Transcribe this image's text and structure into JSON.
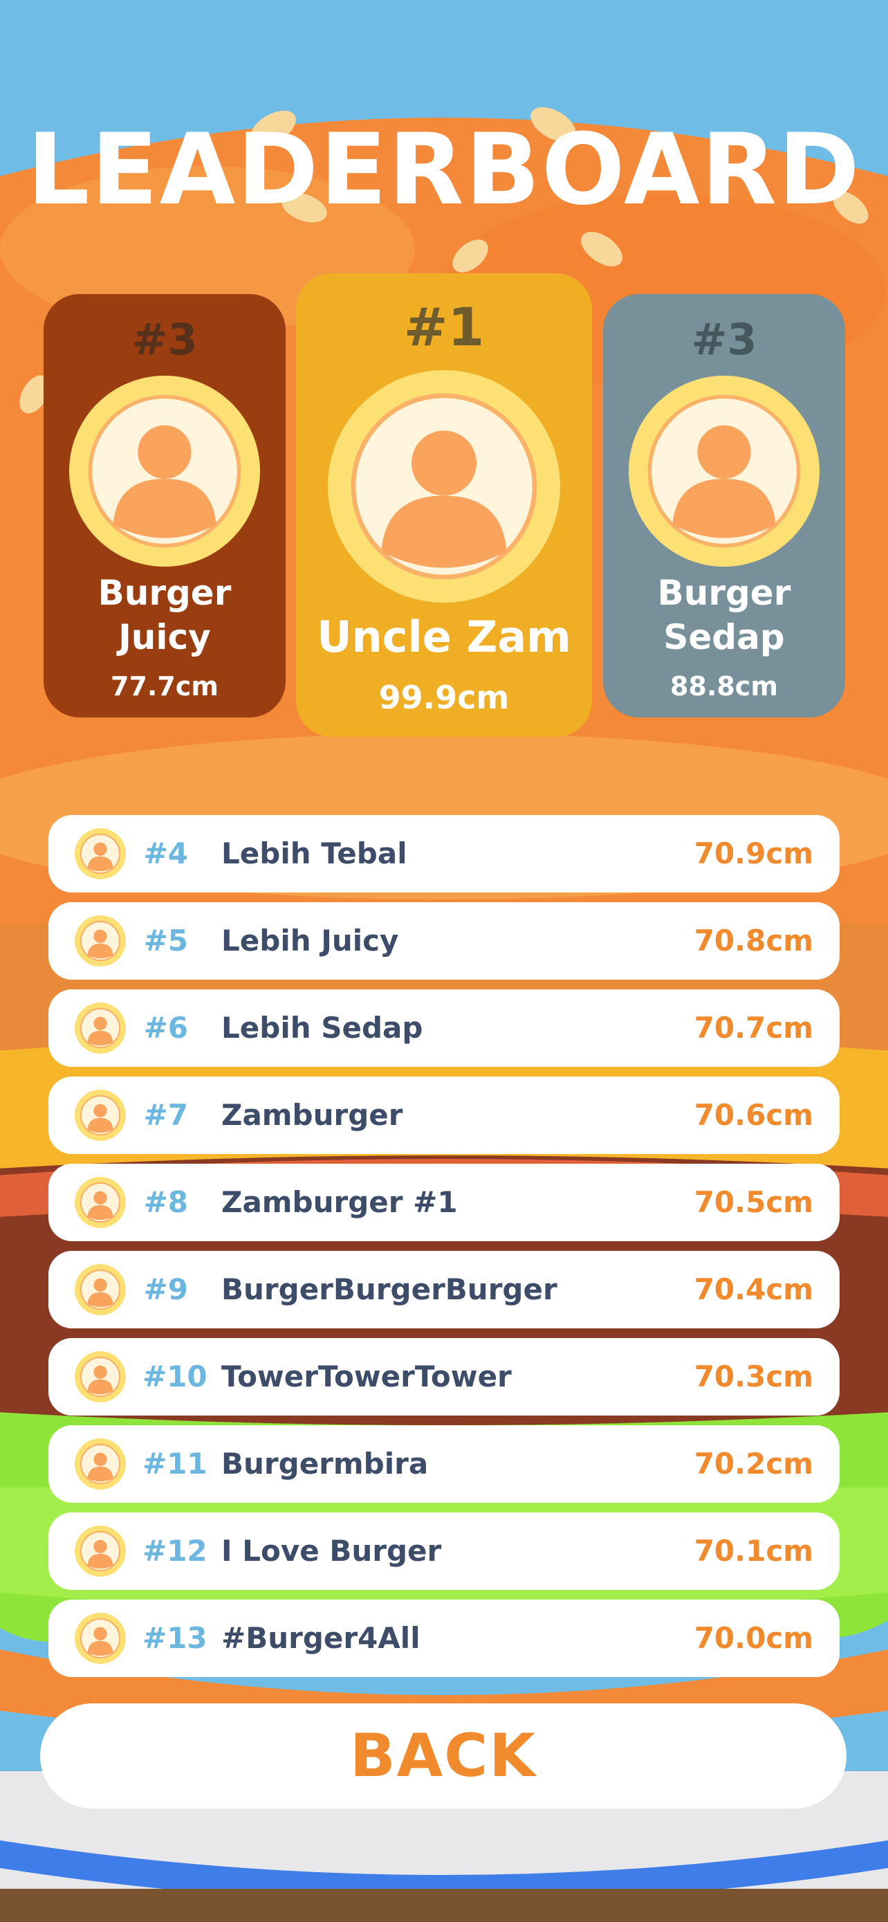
{
  "title": "LEADERBOARD",
  "podium": {
    "left": {
      "rank": "#3",
      "name_line1": "Burger",
      "name_line2": "Juicy",
      "score": "77.7cm"
    },
    "center": {
      "rank": "#1",
      "name": "Uncle Zam",
      "score": "99.9cm"
    },
    "right": {
      "rank": "#3",
      "name_line1": "Burger",
      "name_line2": "Sedap",
      "score": "88.8cm"
    }
  },
  "rows": [
    {
      "rank": "#4",
      "name": "Lebih Tebal",
      "score": "70.9cm"
    },
    {
      "rank": "#5",
      "name": "Lebih Juicy",
      "score": "70.8cm"
    },
    {
      "rank": "#6",
      "name": "Lebih Sedap",
      "score": "70.7cm"
    },
    {
      "rank": "#7",
      "name": "Zamburger",
      "score": "70.6cm"
    },
    {
      "rank": "#8",
      "name": "Zamburger #1",
      "score": "70.5cm"
    },
    {
      "rank": "#9",
      "name": "BurgerBurgerBurger",
      "score": "70.4cm"
    },
    {
      "rank": "#10",
      "name": "TowerTowerTower",
      "score": "70.3cm"
    },
    {
      "rank": "#11",
      "name": "Burgermbira",
      "score": "70.2cm"
    },
    {
      "rank": "#12",
      "name": "I Love Burger",
      "score": "70.1cm"
    },
    {
      "rank": "#13",
      "name": "#Burger4All",
      "score": "70.0cm"
    }
  ],
  "back_label": "BACK",
  "colors": {
    "sky": "#6fbce6",
    "bun": "#f5893a",
    "rank_blue": "#6cb7e0",
    "name_navy": "#3d4c68",
    "score_orange": "#f08a2c",
    "gold": "#f0ae24",
    "bronze": "#9a3d10",
    "silver": "#78909a"
  }
}
